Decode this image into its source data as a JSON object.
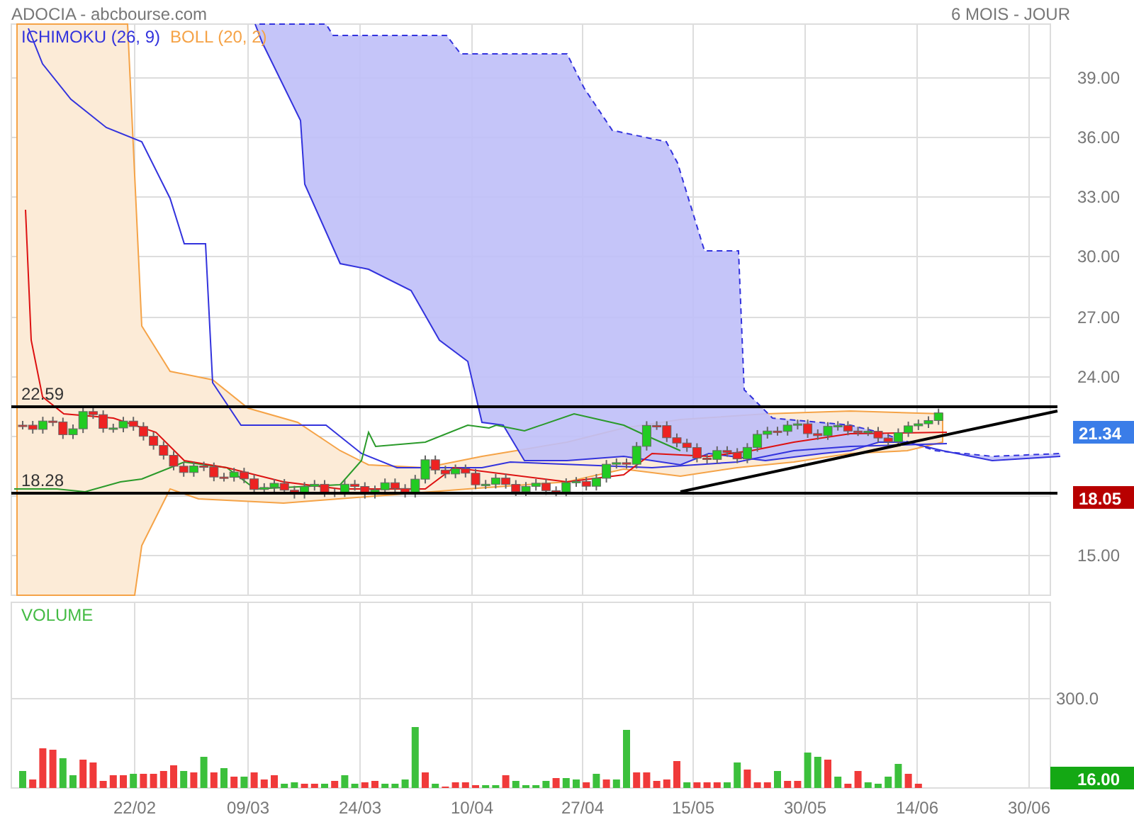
{
  "header": {
    "title": "ADOCIA - abcbourse.com",
    "period": "6 MOIS - JOUR"
  },
  "price_panel": {
    "legend": [
      {
        "label": "ICHIMOKU (26, 9)",
        "color": "#3333dd"
      },
      {
        "label": "BOLL (20, 2)",
        "color": "#f5a347"
      }
    ],
    "y_axis": [
      "39.00",
      "36.00",
      "33.00",
      "30.00",
      "27.00",
      "24.00",
      "15.00"
    ],
    "level_lines": [
      {
        "label": "22.59"
      },
      {
        "label": "18.28"
      }
    ],
    "badges": [
      {
        "label": "21.34",
        "color": "#3a7de8"
      },
      {
        "label": "18.05",
        "color": "#b80000"
      }
    ]
  },
  "volume_panel": {
    "title": "VOLUME",
    "y_axis": [
      "300.0"
    ],
    "badge": {
      "label": "16.00",
      "color": "#14a814"
    }
  },
  "x_axis": [
    "22/02",
    "09/03",
    "24/03",
    "10/04",
    "27/04",
    "15/05",
    "30/05",
    "14/06",
    "30/06"
  ]
}
